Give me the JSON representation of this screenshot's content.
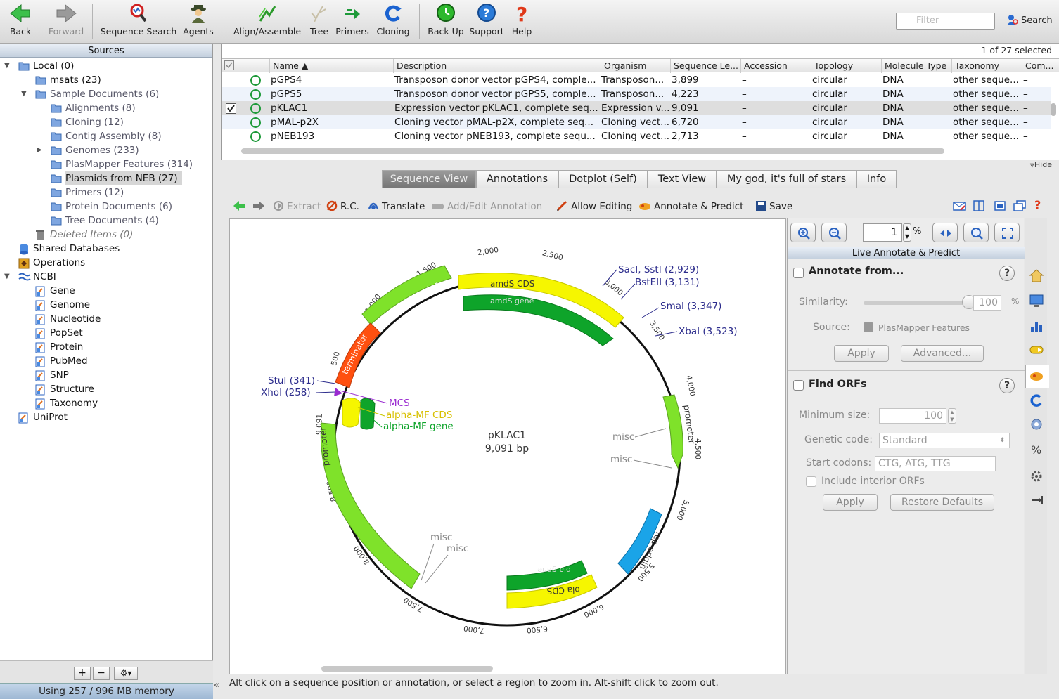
{
  "toolbar": {
    "back": "Back",
    "forward": "Forward",
    "sequence_search": "Sequence Search",
    "agents": "Agents",
    "align_assemble": "Align/Assemble",
    "tree": "Tree",
    "primers": "Primers",
    "cloning": "Cloning",
    "back_up": "Back Up",
    "support": "Support",
    "help": "Help",
    "filter_placeholder": "Filter",
    "search": "Search"
  },
  "sources": {
    "header": "Sources",
    "items": [
      {
        "label": "Local (0)"
      },
      {
        "label": "msats (23)"
      },
      {
        "label": "Sample Documents (6)"
      },
      {
        "label": "Alignments (8)"
      },
      {
        "label": "Cloning (12)"
      },
      {
        "label": "Contig Assembly (8)"
      },
      {
        "label": "Genomes (233)"
      },
      {
        "label": "PlasMapper Features (314)"
      },
      {
        "label": "Plasmids from NEB (27)"
      },
      {
        "label": "Primers (12)"
      },
      {
        "label": "Protein Documents (6)"
      },
      {
        "label": "Tree Documents (4)"
      },
      {
        "label": "Deleted Items (0)"
      },
      {
        "label": "Shared Databases"
      },
      {
        "label": "Operations"
      },
      {
        "label": "NCBI"
      },
      {
        "label": "Gene"
      },
      {
        "label": "Genome"
      },
      {
        "label": "Nucleotide"
      },
      {
        "label": "PopSet"
      },
      {
        "label": "Protein"
      },
      {
        "label": "PubMed"
      },
      {
        "label": "SNP"
      },
      {
        "label": "Structure"
      },
      {
        "label": "Taxonomy"
      },
      {
        "label": "UniProt"
      }
    ],
    "add": "+",
    "remove": "−",
    "gear": "⚙▾",
    "memory": "Using 257 / 996 MB memory",
    "collapse": "«"
  },
  "documents": {
    "selection": "1 of 27 selected",
    "columns": [
      "Name ▲",
      "Description",
      "Organism",
      "Sequence Le...",
      "Accession",
      "Topology",
      "Molecule Type",
      "Taxonomy",
      "Com..."
    ],
    "rows": [
      {
        "name": "pGPS4",
        "description": "Transposon donor vector pGPS4, comple...",
        "organism": "Transposon...",
        "length": "3,899",
        "accession": "–",
        "topology": "circular",
        "molecule": "DNA",
        "taxonomy": "other seque...",
        "com": "–"
      },
      {
        "name": "pGPS5",
        "description": "Transposon donor vector pGPS5, comple...",
        "organism": "Transposon...",
        "length": "4,223",
        "accession": "–",
        "topology": "circular",
        "molecule": "DNA",
        "taxonomy": "other seque...",
        "com": "–"
      },
      {
        "name": "pKLAC1",
        "description": "Expression vector pKLAC1, complete seq...",
        "organism": "Expression v...",
        "length": "9,091",
        "accession": "–",
        "topology": "circular",
        "molecule": "DNA",
        "taxonomy": "other seque...",
        "com": "–"
      },
      {
        "name": "pMAL-p2X",
        "description": "Cloning vector pMAL-p2X, complete seq...",
        "organism": "Cloning vect...",
        "length": "6,720",
        "accession": "–",
        "topology": "circular",
        "molecule": "DNA",
        "taxonomy": "other seque...",
        "com": "–"
      },
      {
        "name": "pNEB193",
        "description": "Cloning vector pNEB193, complete sequ...",
        "organism": "Cloning vect...",
        "length": "2,713",
        "accession": "–",
        "topology": "circular",
        "molecule": "DNA",
        "taxonomy": "other seque...",
        "com": "–"
      }
    ],
    "hide": "⩔Hide"
  },
  "tabs": [
    "Sequence View",
    "Annotations",
    "Dotplot (Self)",
    "Text View",
    "My god, it's full of stars",
    "Info"
  ],
  "seq_toolbar": {
    "extract": "Extract",
    "rc": "R.C.",
    "translate": "Translate",
    "add_edit": "Add/Edit Annotation",
    "allow_editing": "Allow Editing",
    "annotate_predict": "Annotate & Predict",
    "save": "Save"
  },
  "map": {
    "name": "pKLAC1",
    "length": "9,091 bp",
    "ticks": [
      "500",
      "1,000",
      "1,500",
      "2,000",
      "2,500",
      "3,000",
      "3,500",
      "4,000",
      "4,500",
      "5,000",
      "5,500",
      "6,000",
      "6,500",
      "7,000",
      "7,500",
      "8,000",
      "8,500",
      "9,091"
    ],
    "features": {
      "promoter": "promoter",
      "terminator": "terminator",
      "amds_cds": "amdS CDS",
      "amds_gene": "amdS gene",
      "rep_origin": "rep origin",
      "bla_cds": "bla CDS",
      "bla_gene": "bla gene"
    },
    "labels": {
      "saci": "SacI, SstI (2,929)",
      "bsteii": "BstEII (3,131)",
      "smai": "SmaI (3,347)",
      "xbai": "XbaI (3,523)",
      "stui": "StuI (341)",
      "xhoi": "XhoI (258)",
      "mcs": "MCS",
      "alpha_cds": "alpha-MF CDS",
      "alpha_gene": "alpha-MF gene",
      "misc": "misc"
    },
    "colors": {
      "promoter": "#7fe22a",
      "terminator": "#ff5010",
      "cds": "#f6f600",
      "gene": "#0ea42a",
      "origin": "#1aa4e8",
      "site": "#2c2c8c"
    }
  },
  "status": "Alt click on a sequence position or annotation, or select a region to zoom in. Alt-shift click to zoom out.",
  "side": {
    "zoom_value": "1",
    "zoom_unit": "%",
    "live_header": "Live Annotate & Predict",
    "annotate_from": "Annotate from...",
    "similarity_label": "Similarity:",
    "similarity_value": "100",
    "similarity_unit": "%",
    "similarity_level": 1.0,
    "source_label": "Source:",
    "source_value": "PlasMapper Features",
    "apply": "Apply",
    "advanced": "Advanced...",
    "find_orfs": "Find ORFs",
    "min_size_label": "Minimum size:",
    "min_size_value": "100",
    "genetic_code_label": "Genetic code:",
    "genetic_code_value": "Standard",
    "start_codons_label": "Start codons:",
    "start_codons_value": "CTG, ATG, TTG",
    "include_interior": "Include interior ORFs",
    "apply2": "Apply",
    "restore": "Restore Defaults",
    "help": "?"
  }
}
